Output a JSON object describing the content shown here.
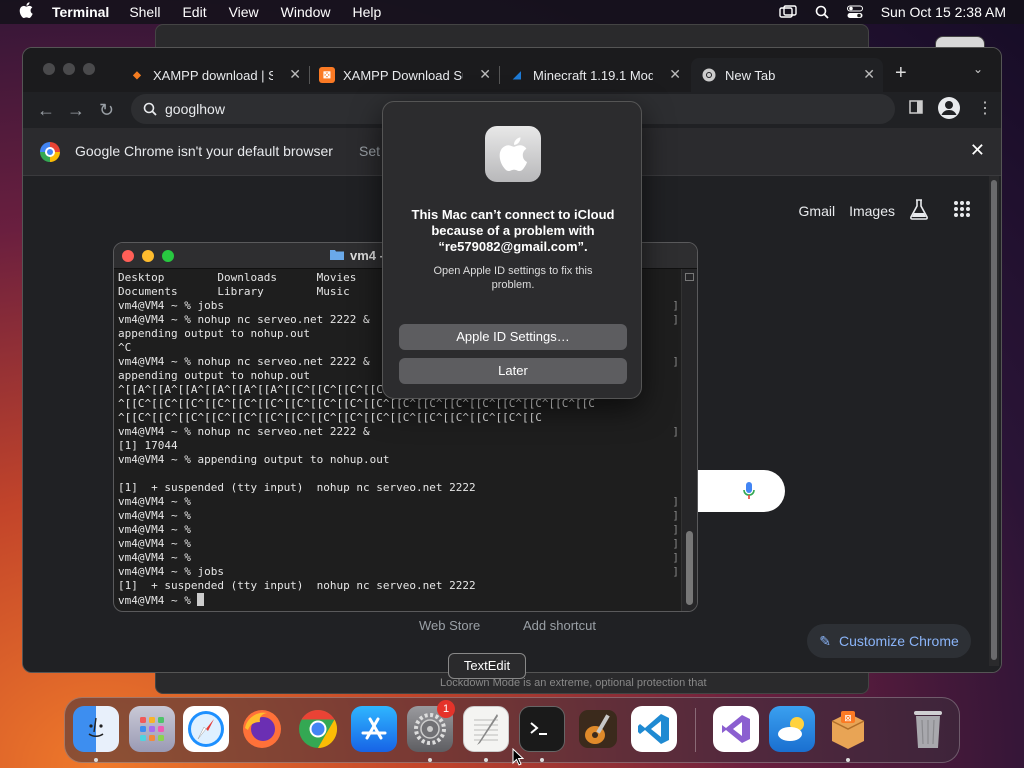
{
  "menubar": {
    "app_name": "Terminal",
    "menus": [
      "Shell",
      "Edit",
      "View",
      "Window",
      "Help"
    ],
    "clock": "Sun Oct 15  2:38 AM"
  },
  "chrome": {
    "tabs": [
      {
        "title": "XAMPP download | So",
        "favicon_color": "#f47c20"
      },
      {
        "title": "XAMPP Download Sur",
        "favicon_color": "#fb7a24"
      },
      {
        "title": "Minecraft 1.19.1 Modp",
        "favicon_color": "#1e7bd6"
      },
      {
        "title": "New Tab",
        "favicon_color": "#cccccc"
      }
    ],
    "omnibox_text": "googlhow",
    "infobar": {
      "message": "Google Chrome isn't your default browser",
      "action": "Set"
    },
    "top_links": {
      "gmail": "Gmail",
      "images": "Images"
    },
    "shortcuts": {
      "web_store": "Web Store",
      "add_shortcut": "Add shortcut"
    },
    "customize_label": "Customize Chrome"
  },
  "terminal": {
    "title": "vm4 -",
    "lines": [
      "Desktop        Downloads      Movies",
      "Documents      Library        Music",
      "vm4@VM4 ~ % jobs",
      "vm4@VM4 ~ % nohup nc serveo.net 2222 &",
      "appending output to nohup.out",
      "^C",
      "vm4@VM4 ~ % nohup nc serveo.net 2222 &",
      "appending output to nohup.out",
      "^[[A^[[A^[[A^[[A^[[A^[[A^[[C^[[C^[[C^[[C^[[C^[[C^[[C^[[C^[[C^[[C^[[C^[[C",
      "^[[C^[[C^[[C^[[C^[[C^[[C^[[C^[[C^[[C^[[C^[[C^[[C^[[C^[[C^[[C^[[C^[[C^[[C",
      "^[[C^[[C^[[C^[[C^[[C^[[C^[[C^[[C^[[C^[[C^[[C^[[C^[[C^[[C^[[C^[[C",
      "vm4@VM4 ~ % nohup nc serveo.net 2222 &",
      "[1] 17044",
      "vm4@VM4 ~ % appending output to nohup.out",
      "",
      "[1]  + suspended (tty input)  nohup nc serveo.net 2222",
      "vm4@VM4 ~ %",
      "vm4@VM4 ~ %",
      "vm4@VM4 ~ %",
      "vm4@VM4 ~ %",
      "vm4@VM4 ~ %",
      "vm4@VM4 ~ % jobs",
      "[1]  + suspended (tty input)  nohup nc serveo.net 2222",
      "vm4@VM4 ~ % "
    ]
  },
  "dialog": {
    "title": "This Mac can’t connect to iCloud because of a problem with “re579082@gmail.com”.",
    "message": "Open Apple ID settings to fix this problem.",
    "primary_button": "Apple ID Settings…",
    "secondary_button": "Later"
  },
  "tooltip": "TextEdit",
  "background_text": {
    "lockdown": "Lockdown Mode is an extreme, optional protection that"
  },
  "dock": {
    "settings_badge": "1",
    "apps": [
      "finder",
      "launchpad",
      "safari",
      "firefox",
      "chrome",
      "app-store",
      "system-settings",
      "textedit",
      "terminal",
      "garageband",
      "vscode",
      "visual-studio",
      "weather",
      "xampp",
      "trash"
    ]
  }
}
